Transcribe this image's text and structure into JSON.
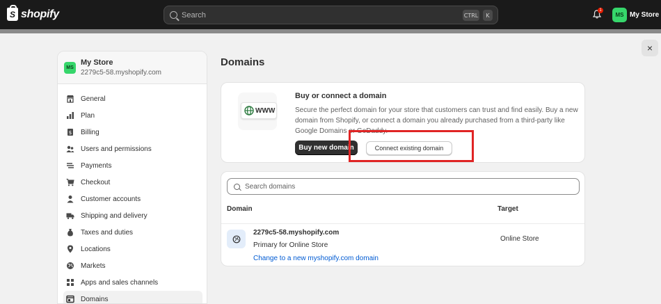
{
  "topbar": {
    "brand": "shopify",
    "search_placeholder": "Search",
    "shortcut_ctrl": "CTRL",
    "shortcut_k": "K",
    "notification_count": "1",
    "avatar_initials": "MS",
    "store_name": "My Store"
  },
  "modal": {
    "close_label": "×"
  },
  "sidebar": {
    "store": {
      "initials": "MS",
      "name": "My Store",
      "url": "2279c5-58.myshopify.com"
    },
    "items": [
      {
        "label": "General",
        "icon": "store-icon"
      },
      {
        "label": "Plan",
        "icon": "plan-icon"
      },
      {
        "label": "Billing",
        "icon": "billing-icon"
      },
      {
        "label": "Users and permissions",
        "icon": "users-icon"
      },
      {
        "label": "Payments",
        "icon": "payments-icon"
      },
      {
        "label": "Checkout",
        "icon": "cart-icon"
      },
      {
        "label": "Customer accounts",
        "icon": "person-icon"
      },
      {
        "label": "Shipping and delivery",
        "icon": "truck-icon"
      },
      {
        "label": "Taxes and duties",
        "icon": "tax-icon"
      },
      {
        "label": "Locations",
        "icon": "location-icon"
      },
      {
        "label": "Markets",
        "icon": "globe-icon"
      },
      {
        "label": "Apps and sales channels",
        "icon": "apps-icon"
      },
      {
        "label": "Domains",
        "icon": "domains-icon",
        "active": true
      }
    ]
  },
  "main": {
    "title": "Domains",
    "buy_card": {
      "illustration_text": "WWW",
      "title": "Buy or connect a domain",
      "description": "Secure the perfect domain for your store that customers can trust and find easily. Buy a new domain from Shopify, or connect a domain you already purchased from a third-party like Google Domains or GoDaddy.",
      "buy_button": "Buy new domain",
      "connect_button": "Connect existing domain"
    },
    "domains_card": {
      "search_placeholder": "Search domains",
      "columns": [
        "Domain",
        "Target"
      ],
      "rows": [
        {
          "domain": "2279c5-58.myshopify.com",
          "subtitle": "Primary for Online Store",
          "link": "Change to a new myshopify.com domain",
          "target": "Online Store"
        }
      ]
    }
  },
  "colors": {
    "topbar": "#1a1a1a",
    "avatar": "#36d66b",
    "highlight": "#e02424",
    "link": "#005bd3"
  }
}
